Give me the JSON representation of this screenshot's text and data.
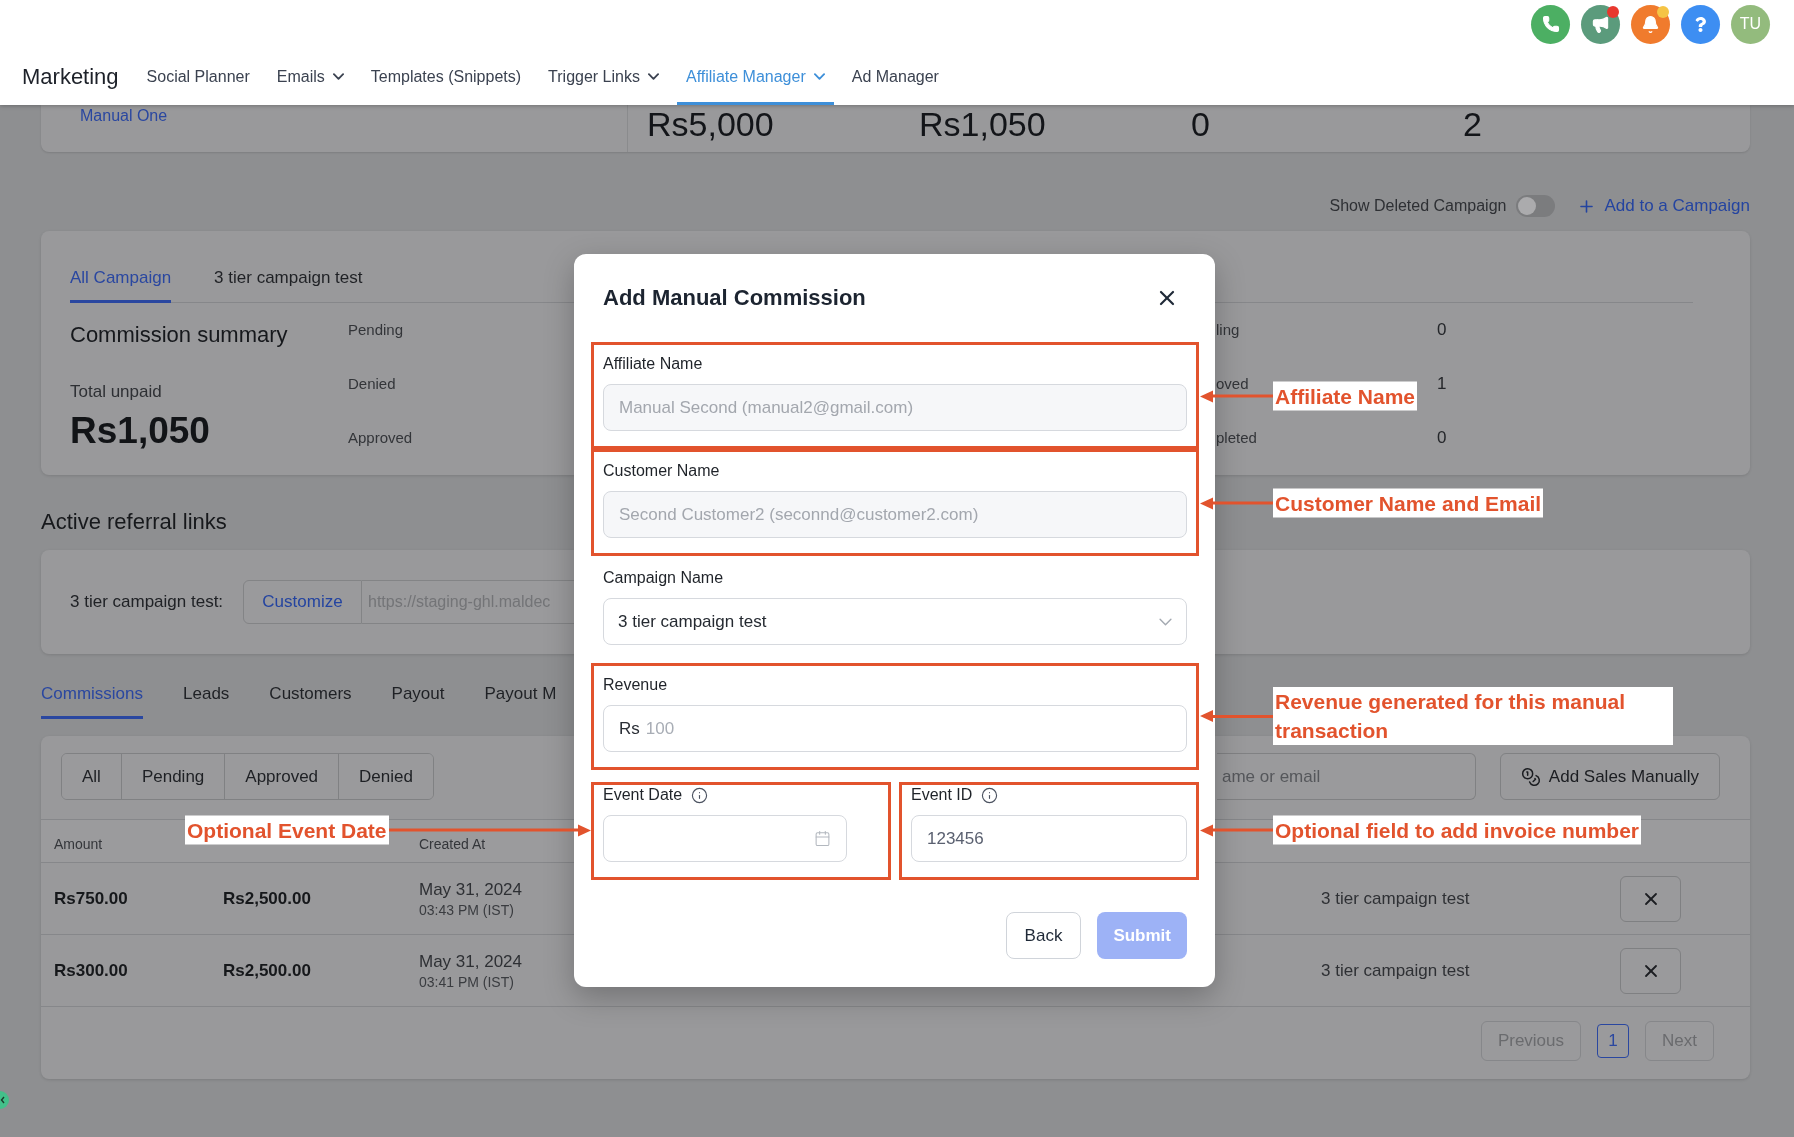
{
  "header": {
    "title": "Marketing",
    "nav": [
      {
        "label": "Social Planner",
        "dropdown": false,
        "selected": false
      },
      {
        "label": "Emails",
        "dropdown": true,
        "selected": false
      },
      {
        "label": "Templates (Snippets)",
        "dropdown": false,
        "selected": false
      },
      {
        "label": "Trigger Links",
        "dropdown": true,
        "selected": false
      },
      {
        "label": "Affiliate Manager",
        "dropdown": true,
        "selected": true
      },
      {
        "label": "Ad Manager",
        "dropdown": false,
        "selected": false
      }
    ],
    "actions": [
      {
        "kind": "phone",
        "color": "#4caf63"
      },
      {
        "kind": "megaphone",
        "color": "#5b9b7c",
        "dot": {
          "color": "#e8382e"
        }
      },
      {
        "kind": "bell",
        "color": "#f07b2d",
        "dot": {
          "color": "#f5c445"
        }
      },
      {
        "kind": "help",
        "color": "#3d8ef2"
      }
    ],
    "avatar": {
      "initials": "TU"
    }
  },
  "affiliate_strip": {
    "link": "Manual One",
    "stats": [
      "Rs5,000",
      "Rs1,050",
      "0",
      "2"
    ]
  },
  "campaign_toolbar": {
    "toggle": {
      "label": "Show Deleted Campaign",
      "on": false
    },
    "add_link": "Add to a Campaign"
  },
  "campaign_card": {
    "tabs": [
      {
        "label": "All Campaign",
        "selected": true
      },
      {
        "label": "3 tier campaign test",
        "selected": false
      }
    ],
    "title": "Commission summary",
    "total_label": "Total unpaid",
    "total": "Rs1,050",
    "status_labels": [
      "Pending",
      "Denied",
      "Approved"
    ],
    "status_counts": [
      {
        "label": "ling",
        "value": "0"
      },
      {
        "label": "oved",
        "value": "1"
      },
      {
        "label": "pleted",
        "value": "0"
      }
    ]
  },
  "referral_links": {
    "heading": "Active referral links",
    "items": [
      {
        "label": "3 tier campaign test:",
        "button": "Customize",
        "url": "https://staging-ghl.maldec"
      }
    ]
  },
  "records": {
    "tabs": [
      {
        "label": "Commissions",
        "selected": true
      },
      {
        "label": "Leads",
        "selected": false
      },
      {
        "label": "Customers",
        "selected": false
      },
      {
        "label": "Payout",
        "selected": false
      },
      {
        "label": "Payout M",
        "selected": false
      }
    ],
    "filters": [
      "All",
      "Pending",
      "Approved",
      "Denied"
    ],
    "search": {
      "placeholder": "ame or email"
    },
    "add_button": "Add Sales Manually",
    "table": {
      "columns": {
        "amount": "Amount",
        "created_at": "Created At"
      },
      "rows": [
        {
          "amount": "Rs750.00",
          "column_2": "Rs2,500.00",
          "created_date": "May 31, 2024",
          "created_time": "03:43 PM (IST)",
          "column_4": "3 tier campaign test"
        },
        {
          "amount": "Rs300.00",
          "column_2": "Rs2,500.00",
          "created_date": "May 31, 2024",
          "created_time": "03:41 PM (IST)",
          "column_4": "3 tier campaign test"
        }
      ]
    },
    "pagination": {
      "previous": {
        "label": "Previous",
        "disabled": true
      },
      "pages": [
        {
          "label": "1",
          "selected": true
        }
      ],
      "next": {
        "label": "Next",
        "disabled": true
      }
    }
  },
  "modal": {
    "title": "Add Manual Commission",
    "fields": [
      {
        "kind": "text",
        "label": "Affiliate Name",
        "value": "Manual Second (manual2@gmail.com)",
        "disabled": true,
        "info": false,
        "highlighted": true
      },
      {
        "kind": "text",
        "label": "Customer Name",
        "value": "Second Customer2 (seconnd@customer2.com)",
        "disabled": true,
        "info": false,
        "highlighted": true
      },
      {
        "kind": "select",
        "label": "Campaign Name",
        "value": "3 tier campaign test",
        "disabled": false,
        "info": false,
        "highlighted": false
      },
      {
        "kind": "currency",
        "label": "Revenue",
        "prefix": "Rs",
        "placeholder": "100",
        "disabled": false,
        "info": false,
        "highlighted": true
      }
    ],
    "event_fields": [
      {
        "kind": "date",
        "label": "Event Date",
        "disabled": false,
        "info": true,
        "highlighted": true
      },
      {
        "kind": "text",
        "label": "Event ID",
        "value": "123456",
        "disabled": false,
        "info": true,
        "highlighted": true
      }
    ],
    "buttons": [
      {
        "kind": "secondary",
        "label": "Back",
        "disabled": false
      },
      {
        "kind": "primary",
        "label": "Submit",
        "disabled": true
      }
    ]
  },
  "annotations": [
    {
      "text": "Affiliate Name",
      "kind": "right"
    },
    {
      "text": "Customer Name and Email",
      "kind": "right"
    },
    {
      "text": "Revenue generated for this manual transaction",
      "kind": "right"
    },
    {
      "text": "Optional Event Date",
      "kind": "left"
    },
    {
      "text": "Optional field to add invoice number",
      "kind": "right"
    }
  ]
}
